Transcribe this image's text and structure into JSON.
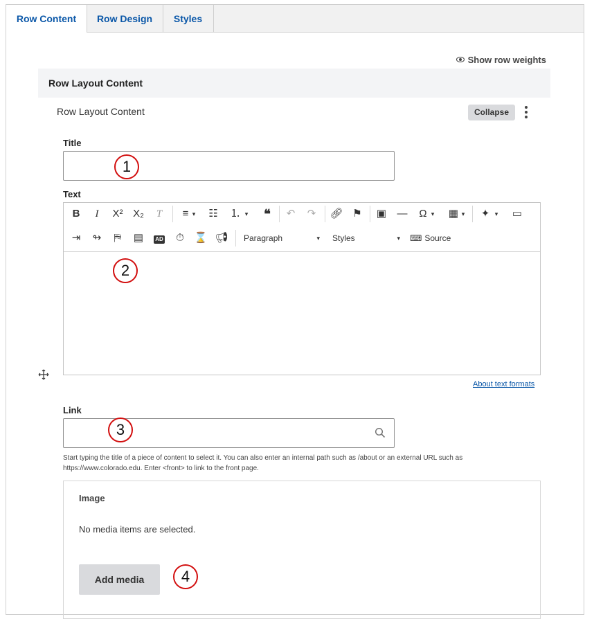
{
  "tabs": [
    {
      "label": "Row Content",
      "active": true
    },
    {
      "label": "Row Design",
      "active": false
    },
    {
      "label": "Styles",
      "active": false
    }
  ],
  "show_row_weights": "Show row weights",
  "section_header": "Row Layout Content",
  "row": {
    "title": "Row Layout Content",
    "collapse_label": "Collapse"
  },
  "fields": {
    "title_label": "Title",
    "text_label": "Text",
    "link_label": "Link",
    "link_help": "Start typing the title of a piece of content to select it. You can also enter an internal path such as /about or an external URL such as https://www.colorado.edu. Enter <front> to link to the front page.",
    "about_text_formats": "About text formats"
  },
  "editor_toolbar": {
    "paragraph_label": "Paragraph",
    "styles_label": "Styles",
    "source_label": "Source"
  },
  "image": {
    "label": "Image",
    "empty_message": "No media items are selected.",
    "add_media_label": "Add media"
  },
  "annotations": [
    "1",
    "2",
    "3",
    "4"
  ],
  "colors": {
    "link_blue": "#0a57a8",
    "annotation_red": "#d20e0e",
    "tab_bar_bg": "#f1f1f1"
  }
}
